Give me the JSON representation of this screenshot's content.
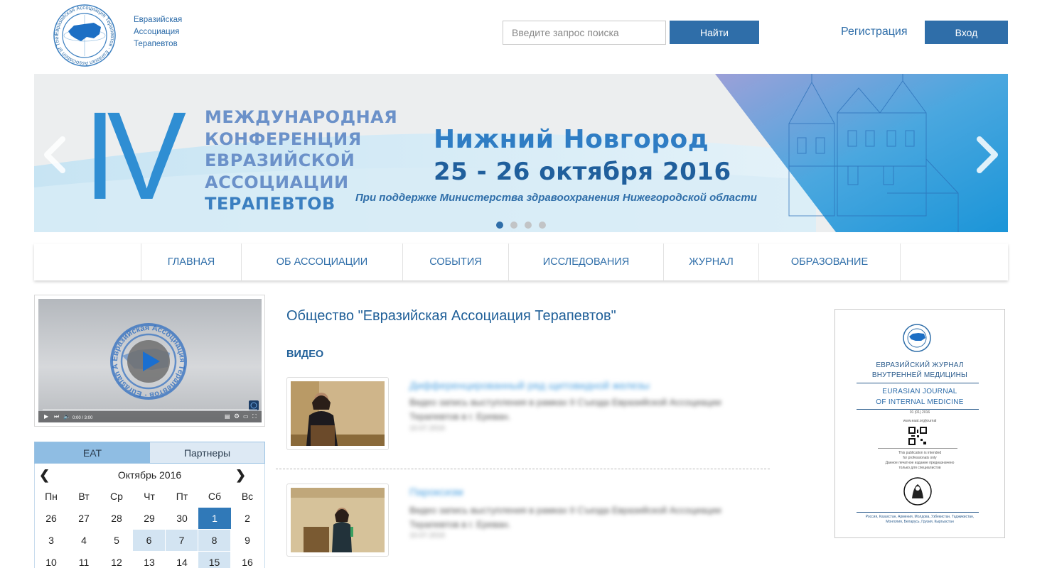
{
  "header": {
    "logo_text": [
      "Евразийская",
      "Ассоциация",
      "Терапевтов"
    ],
    "logo_ring_text": "Евразийская Ассоциация Терапевтов · Eurasian Association of Therapists",
    "search_placeholder": "Введите запрос поиска",
    "search_button": "Найти",
    "register_link": "Регистрация",
    "login_button": "Вход"
  },
  "banner": {
    "roman_numeral": "IV",
    "title_lines": [
      "МЕЖДУНАРОДНАЯ",
      "КОНФЕРЕНЦИЯ",
      "ЕВРАЗИЙСКОЙ",
      "АССОЦИАЦИИ",
      "ТЕРАПЕВТОВ"
    ],
    "city": "Нижний Новгород",
    "dates": "25 - 26 октября 2016",
    "support": "При поддержке Министерства здравоохранения Нижегородской области",
    "active_slide": 1,
    "slide_count": 4
  },
  "nav": {
    "items": [
      "ГЛАВНАЯ",
      "ОБ АССОЦИАЦИИ",
      "СОБЫТИЯ",
      "ИССЛЕДОВАНИЯ",
      "ЖУРНАЛ",
      "ОБРАЗОВАНИЕ"
    ]
  },
  "player": {
    "time": "0:00 / 3:00",
    "logo_ring_text": "Евразийская Ассоциация Терапевтов · Eurasian Association of Therapists"
  },
  "sidebar": {
    "tabs": [
      "ЕАТ",
      "Партнеры"
    ],
    "active_tab": 0
  },
  "calendar": {
    "month": "Октябрь 2016",
    "weekdays": [
      "Пн",
      "Вт",
      "Ср",
      "Чт",
      "Пт",
      "Сб",
      "Вс"
    ],
    "rows": [
      [
        "26",
        "27",
        "28",
        "29",
        "30",
        "1",
        "2"
      ],
      [
        "3",
        "4",
        "5",
        "6",
        "7",
        "8",
        "9"
      ],
      [
        "10",
        "11",
        "12",
        "13",
        "14",
        "15",
        "16"
      ]
    ],
    "today": "1",
    "event_days": [
      "6",
      "7",
      "8",
      "15"
    ]
  },
  "main": {
    "title": "Общество \"Евразийская Ассоциация Терапевтов\"",
    "section": "ВИДЕО",
    "videos": [
      {
        "title": "Дифференцированный ряд щитовидной железы",
        "desc": "Видео запись выступления в рамках II Съезда Евразийской Ассоциации Терапевтов в г. Ереван.",
        "date": "10.07.2016"
      },
      {
        "title": "Пароксизм",
        "desc": "Видео запись выступления в рамках II Съезда Евразийской Ассоциации Терапевтов в г. Ереван.",
        "date": "10.07.2016"
      }
    ]
  },
  "journal": {
    "title_ru": [
      "ЕВРАЗИЙСКИЙ ЖУРНАЛ",
      "ВНУТРЕННЕЙ МЕДИЦИНЫ"
    ],
    "title_en": [
      "EURASIAN JOURNAL",
      "OF INTERNAL MEDICINE"
    ],
    "issue": "01 (01) 2016",
    "url": "www.eaat.org/journal",
    "note_en": [
      "This publication is intended",
      "for professionals only"
    ],
    "note_ru": [
      "Данное печатное издание предназначено",
      "только для специалистов"
    ],
    "countries": [
      "Россия, Казахстан, Армения, Молдова, Узбекистан, Таджикистан,",
      "Монголия, Беларусь, Грузия, Кыргызстан"
    ]
  },
  "colors": {
    "brand_blue": "#2f6ea9",
    "link_blue": "#1f5f98",
    "calendar_today": "#3079b8",
    "calendar_event": "#d3e4f2",
    "tab_active": "#8fbde3",
    "tab_inactive": "#dde9f4"
  }
}
